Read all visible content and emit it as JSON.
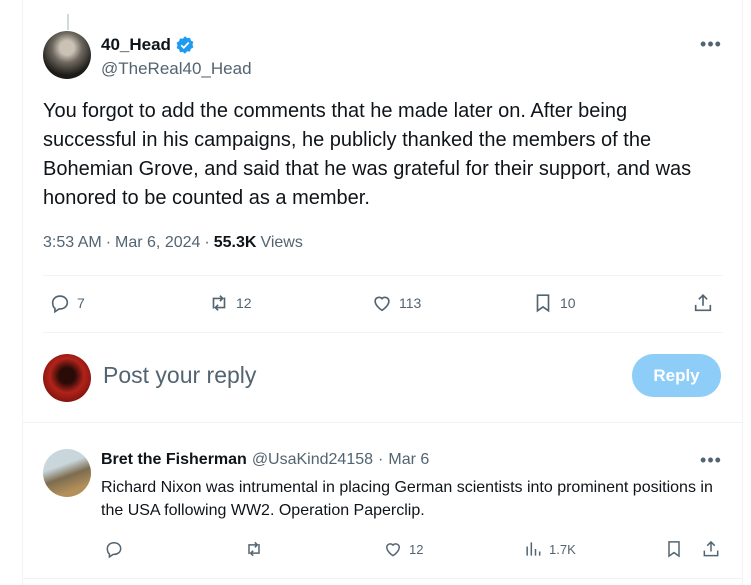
{
  "tweet": {
    "author_name": "40_Head",
    "handle": "@TheReal40_Head",
    "text": "You forgot to add the comments that he made later on. After being successful in his campaigns, he publicly thanked the members of the Bohemian Grove, and said that he was grateful for their support, and was honored to be counted as a member.",
    "time": "3:53 AM",
    "date": "Mar 6, 2024",
    "views_count": "55.3K",
    "views_label": "Views",
    "replies": "7",
    "retweets": "12",
    "likes": "113",
    "bookmarks": "10"
  },
  "composer": {
    "placeholder": "Post your reply",
    "reply_button": "Reply"
  },
  "comment": {
    "author_name": "Bret the Fisherman",
    "handle": "@UsaKind24158",
    "date": "Mar 6",
    "text": "Richard Nixon was intrumental in placing German scientists into prominent positions in the USA following WW2.  Operation Paperclip.",
    "replies": "",
    "retweets": "",
    "likes": "12",
    "views": "1.7K"
  },
  "colors": {
    "verified": "#1d9bf0",
    "reply_button": "#8ecdf8",
    "secondary_text": "#536471"
  }
}
